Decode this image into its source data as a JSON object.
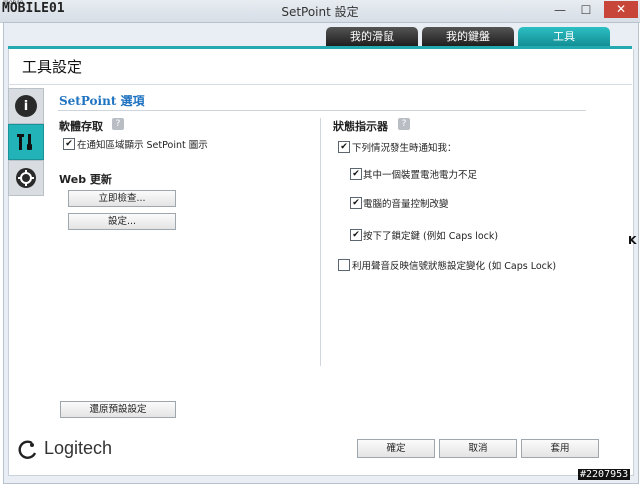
{
  "watermark_top": "MOBILE01",
  "watermark_top_small": "mobile",
  "window": {
    "title": "SetPoint 設定",
    "minimize": "—",
    "maximize": "☐",
    "close": "✕"
  },
  "tabs": [
    {
      "label": "我的滑鼠"
    },
    {
      "label": "我的鍵盤"
    },
    {
      "label": "工具"
    }
  ],
  "page_title": "工具設定",
  "section_title": "SetPoint 選項",
  "software_access": {
    "label": "軟體存取",
    "help": "?",
    "checkbox": {
      "label": "在通知區域顯示 SetPoint 圖示",
      "checked": true
    }
  },
  "web_update": {
    "label": "Web 更新",
    "check_now_button": "立即檢查...",
    "settings_button": "設定..."
  },
  "status_indicator": {
    "label": "狀態指示器",
    "help": "?",
    "main_checkbox": {
      "label": "下列情況發生時通知我：",
      "checked": true
    },
    "sub_options": [
      {
        "label": "其中一個裝置電池電力不足",
        "checked": true
      },
      {
        "label": "電腦的音量控制改變",
        "checked": true
      },
      {
        "label": "按下了鎖定鍵 (例如 Caps lock)",
        "checked": true
      }
    ],
    "sound_checkbox": {
      "label": "利用聲音反映信號狀態設定變化 (如 Caps Lock)",
      "checked": false
    }
  },
  "restore_defaults_button": "還原預設設定",
  "brand": "Logitech",
  "footer_buttons": {
    "ok": "確定",
    "cancel": "取消",
    "apply": "套用"
  },
  "watermark_bottom": "#2207953",
  "edge_char": "K",
  "colors": {
    "accent": "#23aab0",
    "heading_blue": "#1f73c0"
  }
}
